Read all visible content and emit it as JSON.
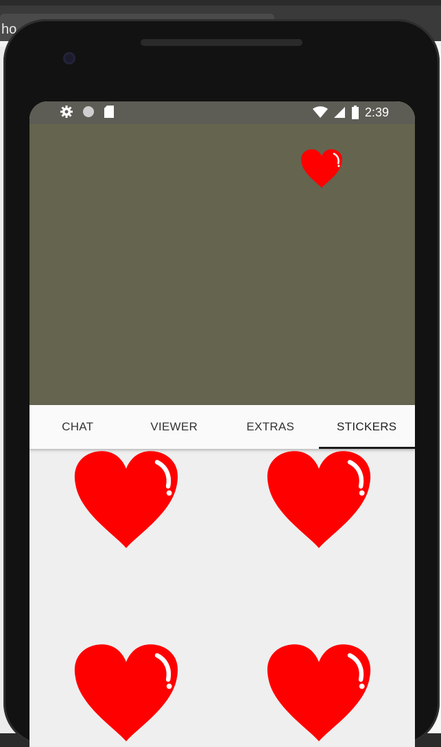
{
  "background_window": {
    "title_fragment": "ho"
  },
  "status_bar": {
    "time": "2:39",
    "left_icons": [
      "settings-icon",
      "circle-icon",
      "sd-card-icon"
    ],
    "right_icons": [
      "wifi-icon",
      "signal-icon",
      "battery-icon"
    ]
  },
  "tabs": [
    {
      "label": "CHAT",
      "active": false
    },
    {
      "label": "VIEWER",
      "active": false
    },
    {
      "label": "EXTRAS",
      "active": false
    },
    {
      "label": "STICKERS",
      "active": true
    }
  ],
  "stickers": [
    {
      "icon": "heart-sticker-icon"
    },
    {
      "icon": "heart-sticker-icon"
    },
    {
      "icon": "heart-sticker-icon"
    },
    {
      "icon": "heart-sticker-icon"
    }
  ],
  "colors": {
    "status_bar": "#5d5d56",
    "viewer_background": "#64644f",
    "heart": "#ff0000",
    "tab_indicator": "#1a1a1a"
  }
}
